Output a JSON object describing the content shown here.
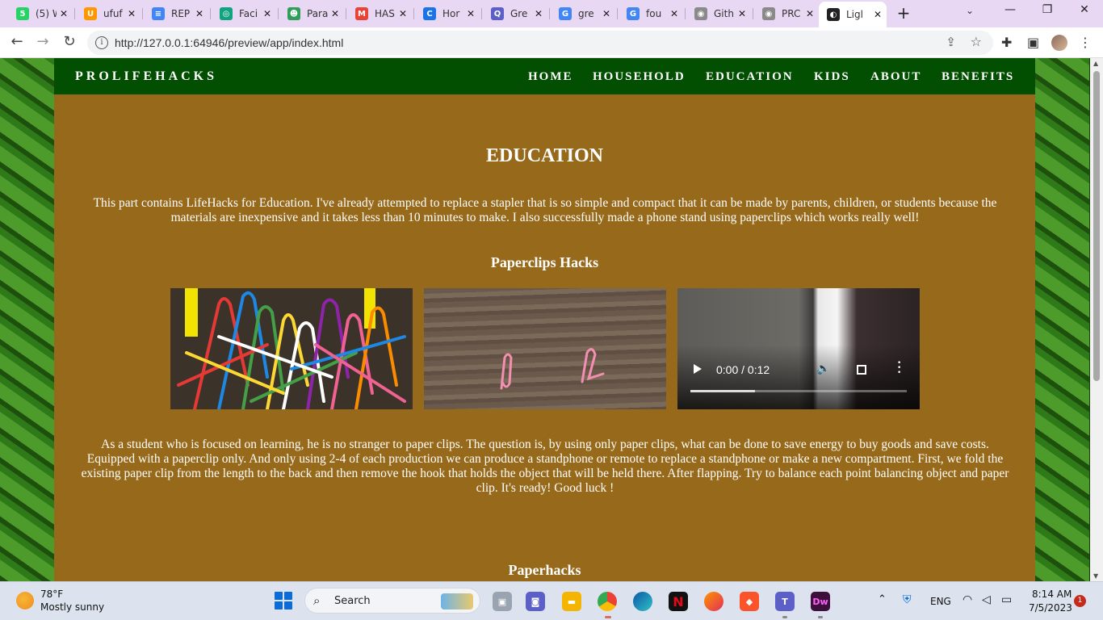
{
  "browser": {
    "tabs": [
      {
        "title": "(5) W",
        "favicon_color": "#25d366",
        "favicon_glyph": "5"
      },
      {
        "title": "ufuf",
        "favicon_color": "#ff9800",
        "favicon_glyph": "U"
      },
      {
        "title": "REP",
        "favicon_color": "#4285f4",
        "favicon_glyph": "≡"
      },
      {
        "title": "Faci",
        "favicon_color": "#10a37f",
        "favicon_glyph": "◎"
      },
      {
        "title": "Para",
        "favicon_color": "#2e9e5a",
        "favicon_glyph": "☻"
      },
      {
        "title": "HAS",
        "favicon_color": "#ea4335",
        "favicon_glyph": "M"
      },
      {
        "title": "Hor",
        "favicon_color": "#1a73e8",
        "favicon_glyph": "C"
      },
      {
        "title": "Gre",
        "favicon_color": "#5b5fc7",
        "favicon_glyph": "Q"
      },
      {
        "title": "gre",
        "favicon_color": "#4285f4",
        "favicon_glyph": "G"
      },
      {
        "title": "fou",
        "favicon_color": "#4285f4",
        "favicon_glyph": "G"
      },
      {
        "title": "Gith",
        "favicon_color": "#8a8a8a",
        "favicon_glyph": "◉"
      },
      {
        "title": "PRC",
        "favicon_color": "#8a8a8a",
        "favicon_glyph": "◉"
      },
      {
        "title": "Ligl",
        "favicon_color": "#222222",
        "favicon_glyph": "◐"
      }
    ],
    "new_tab": "+",
    "url": "http://127.0.0.1:64946/preview/app/index.html"
  },
  "site": {
    "brand": "PROLIFEHACKS",
    "nav": [
      "HOME",
      "HOUSEHOLD",
      "EDUCATION",
      "KIDS",
      "ABOUT",
      "BENEFITS"
    ],
    "page_title": "EDUCATION",
    "intro": "This part contains LifeHacks for Education. I've already attempted to replace a stapler that is so simple and compact that it can be made by parents, children, or students because the materials are inexpensive and it takes less than 10 minutes to make. I also successfully made a phone stand using paperclips which works really well!",
    "section1_title": "Paperclips Hacks",
    "video": {
      "time": "0:00 / 0:12",
      "progress_fraction": 0.3
    },
    "body2": "As a student who is focused on learning, he is no stranger to paper clips. The question is, by using only paper clips, what can be done to save energy to buy goods and save costs. Equipped with a paperclip only. And only using 2-4 of each production we can produce a standphone or remote to replace a standphone or make a new compartment. First, we fold the existing paper clip from the length to the back and then remove the hook that holds the object that will be held there. After flapping. Try to balance each point balancing object and paper clip. It's ready! Good luck !",
    "section2_title": "Paperhacks"
  },
  "taskbar": {
    "weather_temp": "78°F",
    "weather_desc": "Mostly sunny",
    "search_label": "Search",
    "lang": "ENG",
    "time": "8:14 AM",
    "date": "7/5/2023",
    "notif_count": "1"
  }
}
